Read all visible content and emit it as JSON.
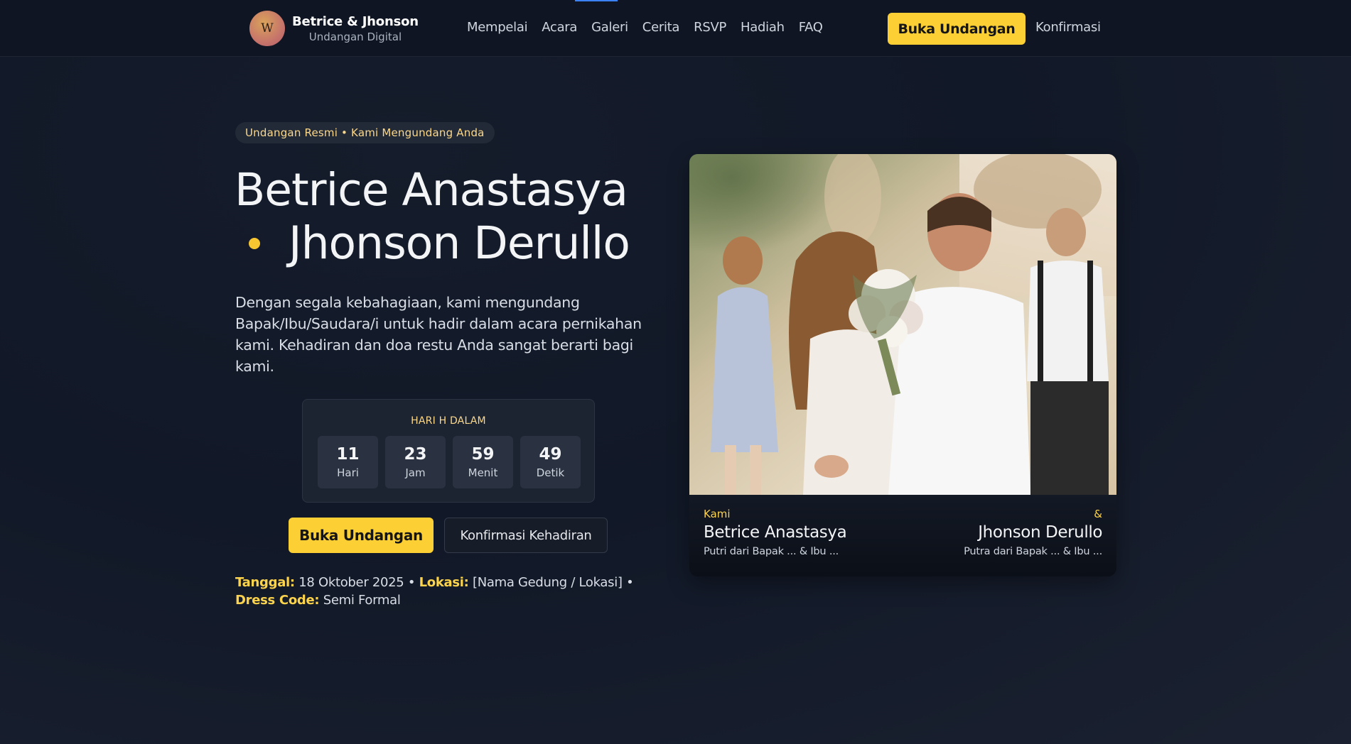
{
  "header": {
    "brand_title": "Betrice & Jhonson",
    "brand_subtitle": "Undangan Digital",
    "logo_letter": "W",
    "nav": [
      "Mempelai",
      "Acara",
      "Galeri",
      "Cerita",
      "RSVP",
      "Hadiah",
      "FAQ"
    ],
    "cta_label": "Buka Undangan",
    "confirm_label": "Konfirmasi"
  },
  "hero": {
    "badge": "Undangan Resmi • Kami Mengundang Anda",
    "name_1": "Betrice Anastasya",
    "name_2": "Jhonson Derullo",
    "description": "Dengan segala kebahagiaan, kami mengundang Bapak/Ibu/Saudara/i untuk hadir dalam acara pernikahan kami. Kehadiran dan doa restu Anda sangat berarti bagi kami.",
    "countdown": {
      "label": "HARI H DALAM",
      "cells": [
        {
          "value": "11",
          "unit": "Hari"
        },
        {
          "value": "23",
          "unit": "Jam"
        },
        {
          "value": "59",
          "unit": "Menit"
        },
        {
          "value": "49",
          "unit": "Detik"
        }
      ]
    },
    "primary_button": "Buka Undangan",
    "secondary_button": "Konfirmasi Kehadiran",
    "info": {
      "date_label": "Tanggal:",
      "date_value": "18 Oktober 2025",
      "location_label": "Lokasi:",
      "location_value": "[Nama Gedung / Lokasi]",
      "dress_label": "Dress Code:",
      "dress_value": "Semi Formal",
      "separator": "•"
    }
  },
  "card": {
    "left_small": "Kami",
    "left_name": "Betrice Anastasya",
    "left_parent": "Putri dari Bapak ... & Ibu ...",
    "right_small": "&",
    "right_name": "Jhonson Derullo",
    "right_parent": "Putra dari Bapak ... & Ibu ..."
  },
  "colors": {
    "accent_yellow": "#fcd034",
    "accent_blue": "#3b82f6",
    "background": "#111827"
  }
}
